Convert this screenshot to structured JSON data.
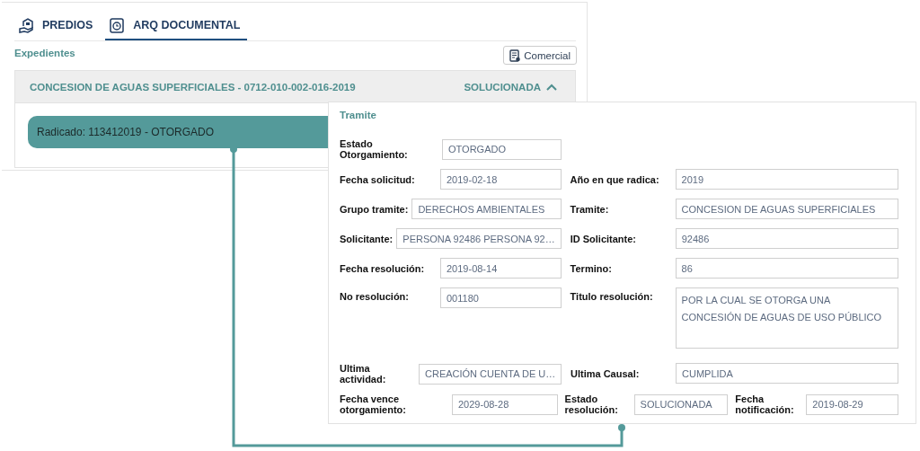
{
  "tabs": [
    {
      "label": "PREDIOS",
      "selected": false
    },
    {
      "label": "ARQ DOCUMENTAL",
      "selected": true
    }
  ],
  "section_title": "Expedientes",
  "comercial_button": "Comercial",
  "expediente": {
    "title": "CONCESION DE AGUAS SUPERFICIALES - 0712-010-002-016-2019",
    "status": "SOLUCIONADA",
    "expanded": true,
    "radicado": "Radicado: 113412019 - OTORGADO"
  },
  "tramite": {
    "title": "Tramite",
    "rows": [
      [
        {
          "label": "Estado Otorgamiento:",
          "value": "OTORGADO",
          "kind": "text"
        }
      ],
      [
        {
          "label": "Fecha solicitud:",
          "value": "2019-02-18",
          "kind": "text"
        },
        {
          "label": "Año en que radica:",
          "value": "2019",
          "kind": "text"
        }
      ],
      [
        {
          "label": "Grupo tramite:",
          "value": "DERECHOS AMBIENTALES",
          "kind": "text"
        },
        {
          "label": "Tramite:",
          "value": "CONCESION DE AGUAS SUPERFICIALES",
          "kind": "text"
        }
      ],
      [
        {
          "label": "Solicitante:",
          "value": "PERSONA 92486 PERSONA 92…",
          "kind": "text"
        },
        {
          "label": "ID Solicitante:",
          "value": "92486",
          "kind": "text"
        }
      ],
      [
        {
          "label": "Fecha resolución:",
          "value": "2019-08-14",
          "kind": "text"
        },
        {
          "label": "Termino:",
          "value": "86",
          "kind": "text"
        }
      ],
      [
        {
          "label": "No resolución:",
          "value": "001180",
          "kind": "text"
        },
        {
          "label": "Titulo resolución:",
          "value": "POR LA CUAL SE OTORGA UNA CONCESIÓN DE AGUAS DE USO PÚBLICO",
          "kind": "multiline"
        }
      ],
      [
        {
          "label": "Ultima actividad:",
          "value": "CREACIÓN CUENTA DE U…",
          "kind": "text"
        },
        {
          "label": "Ultima Causal:",
          "value": "CUMPLIDA",
          "kind": "text"
        }
      ]
    ],
    "footer_row": [
      {
        "label": "Fecha vence otorgamiento:",
        "value": "2029-08-28",
        "kind": "text"
      },
      {
        "label": "Estado resolución:",
        "value": "SOLUCIONADA",
        "kind": "text"
      },
      {
        "label": "Fecha notificación:",
        "value": "2019-08-29",
        "kind": "text"
      }
    ]
  }
}
